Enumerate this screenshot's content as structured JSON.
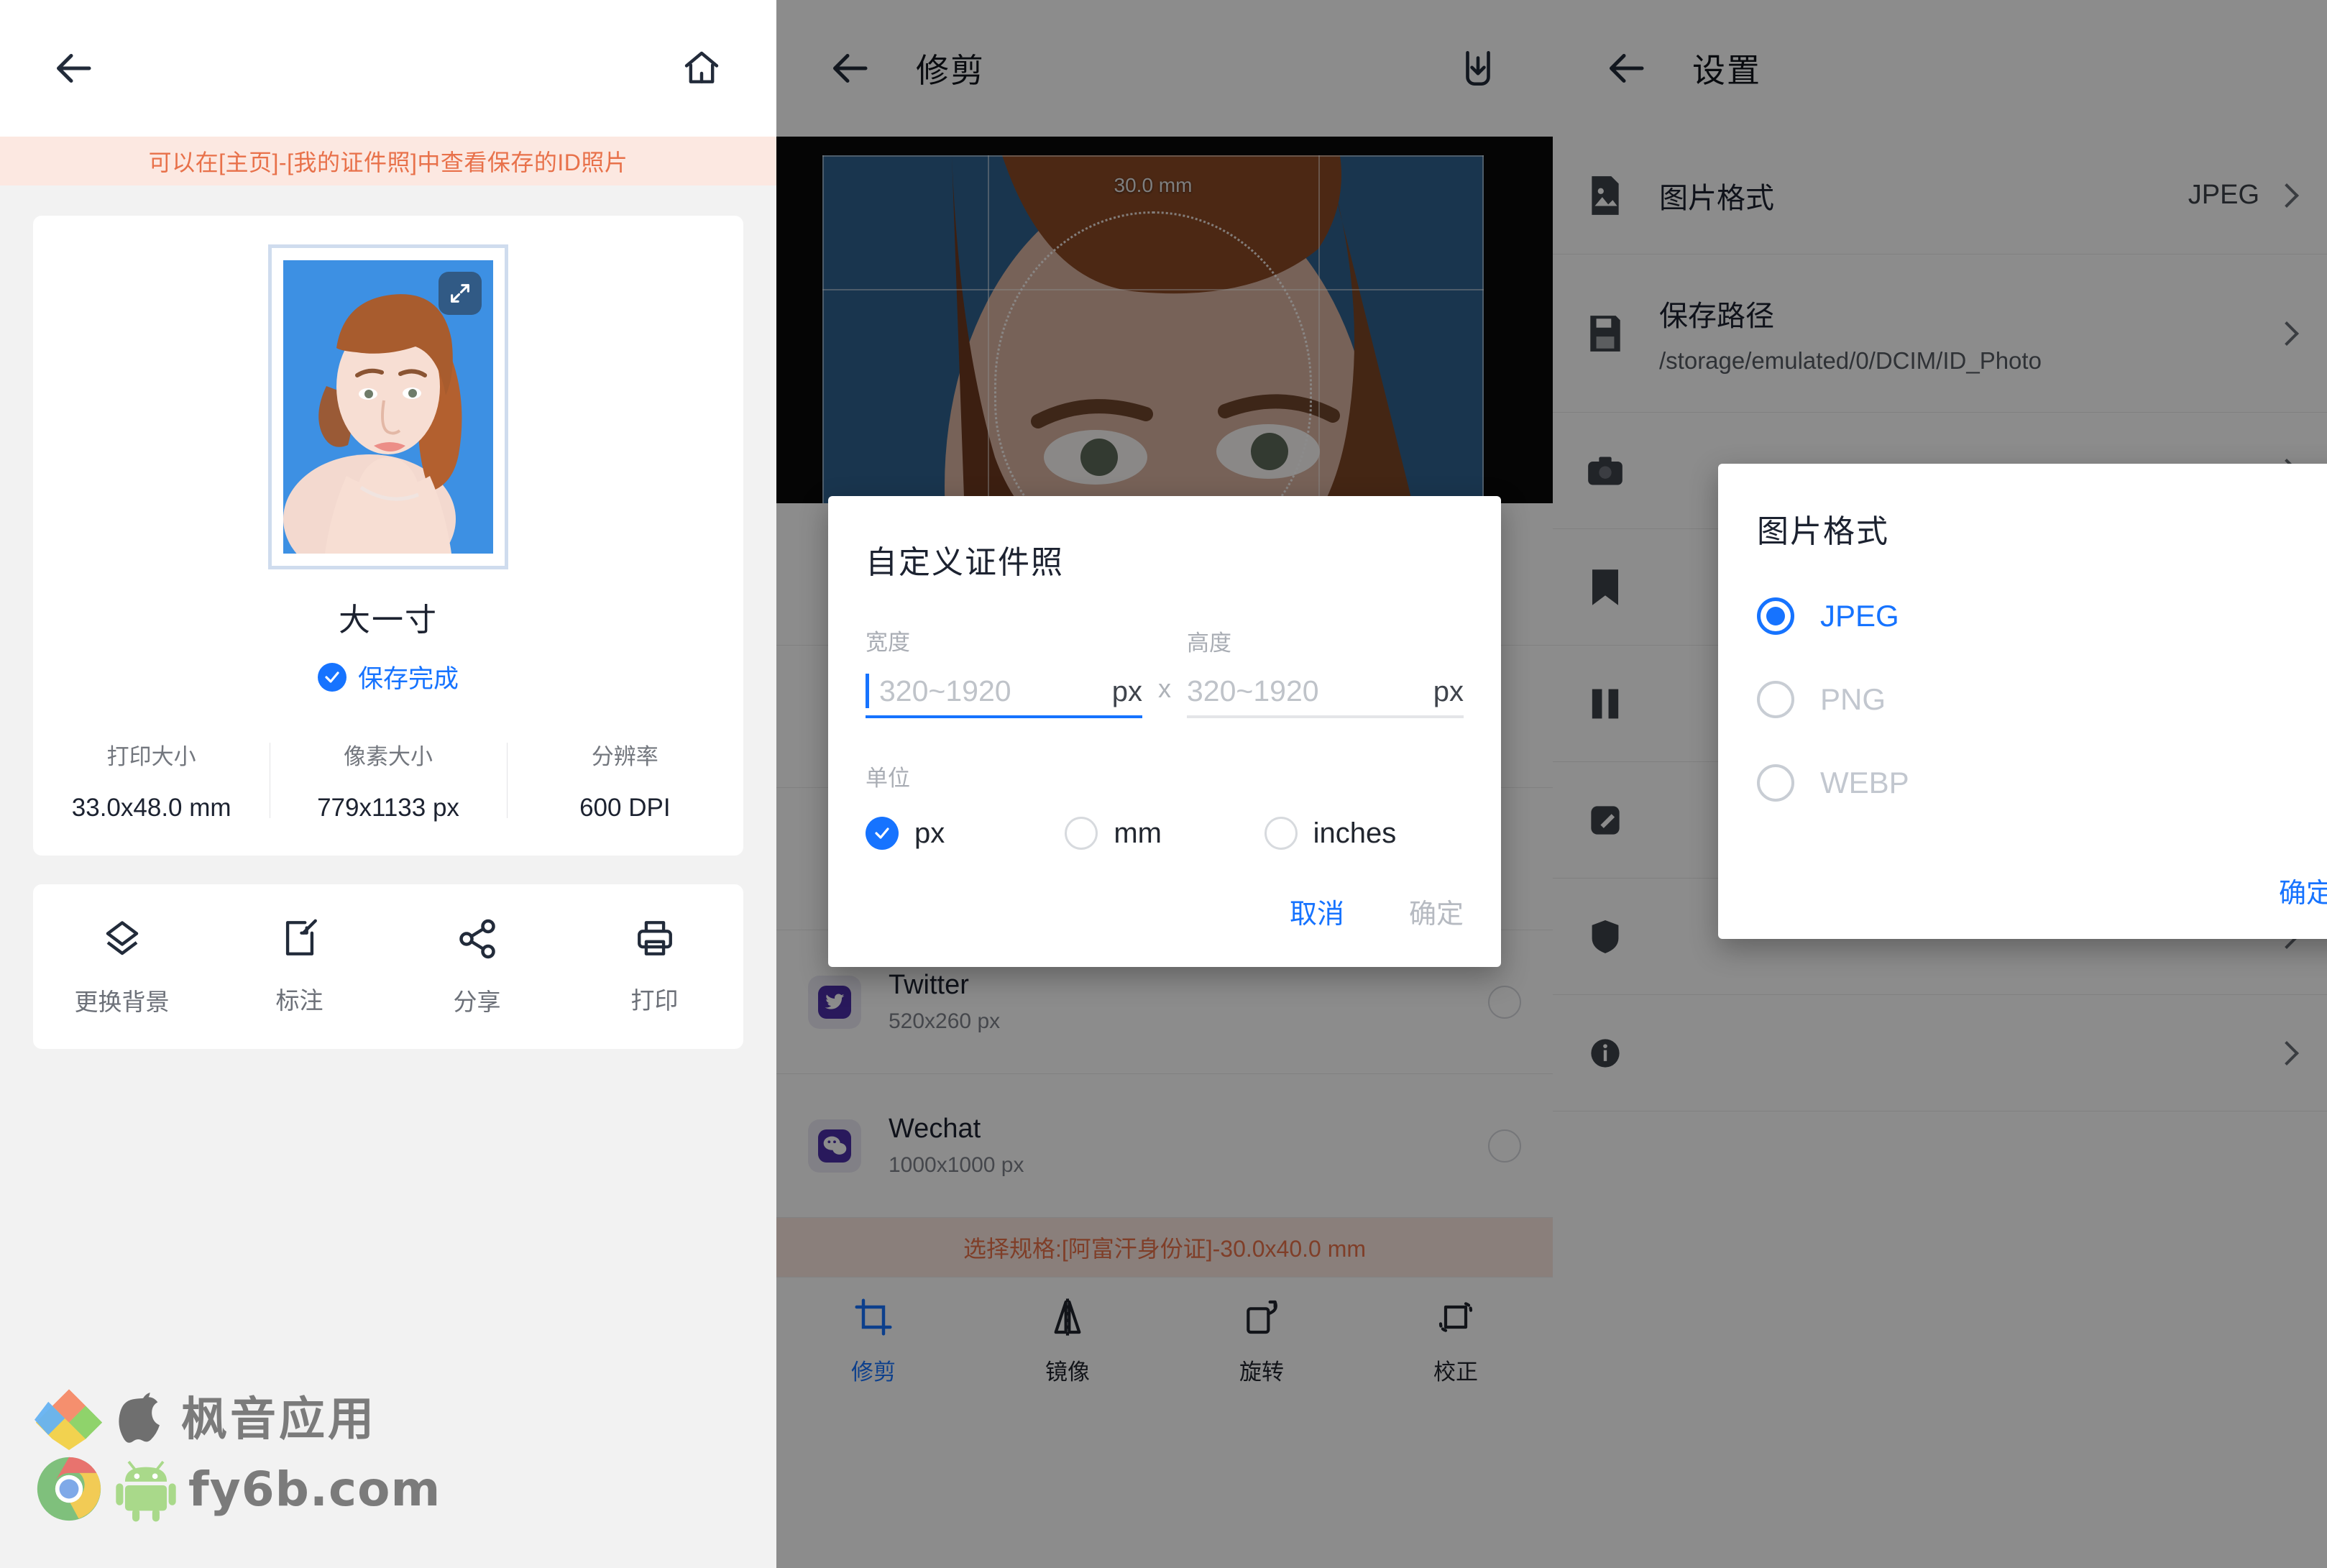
{
  "result_panel": {
    "banner": "可以在[主页]-[我的证件照]中查看保存的ID照片",
    "spec_name": "大一寸",
    "saved_text": "保存完成",
    "meta": [
      {
        "label": "打印大小",
        "value": "33.0x48.0 mm"
      },
      {
        "label": "像素大小",
        "value": "779x1133 px"
      },
      {
        "label": "分辨率",
        "value": "600 DPI"
      }
    ],
    "actions": [
      {
        "label": "更换背景",
        "icon": "layers-icon"
      },
      {
        "label": "标注",
        "icon": "annotate-icon"
      },
      {
        "label": "分享",
        "icon": "share-icon"
      },
      {
        "label": "打印",
        "icon": "print-icon"
      }
    ],
    "watermark_cn": "枫音应用",
    "watermark_url": "fy6b.com"
  },
  "crop_panel": {
    "title": "修剪",
    "crop_width_label": "30.0 mm",
    "hint": "选择规格:[阿富汗身份证]-30.0x40.0 mm",
    "presets": [
      {
        "name": "Twitter",
        "size": "520x260 px"
      },
      {
        "name": "Wechat",
        "size": "1000x1000 px"
      }
    ],
    "tabs": [
      {
        "label": "修剪",
        "active": true
      },
      {
        "label": "镜像",
        "active": false
      },
      {
        "label": "旋转",
        "active": false
      },
      {
        "label": "校正",
        "active": false
      }
    ]
  },
  "custom_dialog": {
    "title": "自定义证件照",
    "width_label": "宽度",
    "height_label": "高度",
    "width_placeholder": "320~1920",
    "height_placeholder": "320~1920",
    "width_unit": "px",
    "height_unit": "px",
    "separator": "x",
    "unit_label": "单位",
    "units": [
      {
        "label": "px",
        "selected": true
      },
      {
        "label": "mm",
        "selected": false
      },
      {
        "label": "inches",
        "selected": false
      }
    ],
    "cancel": "取消",
    "confirm": "确定"
  },
  "settings_panel": {
    "title": "设置",
    "items": [
      {
        "name": "图片格式",
        "value": "JPEG",
        "sub": "",
        "icon": "image-icon"
      },
      {
        "name": "保存路径",
        "value": "",
        "sub": "/storage/emulated/0/DCIM/ID_Photo",
        "icon": "save-icon"
      }
    ]
  },
  "format_dialog": {
    "title": "图片格式",
    "options": [
      {
        "label": "JPEG",
        "selected": true
      },
      {
        "label": "PNG",
        "selected": false
      },
      {
        "label": "WEBP",
        "selected": false
      }
    ],
    "confirm": "确定"
  },
  "colors": {
    "accent": "#1673ff",
    "banner_text": "#e8714a",
    "banner_bg": "#fce8e1",
    "photo_bg": "#3d90e3"
  }
}
